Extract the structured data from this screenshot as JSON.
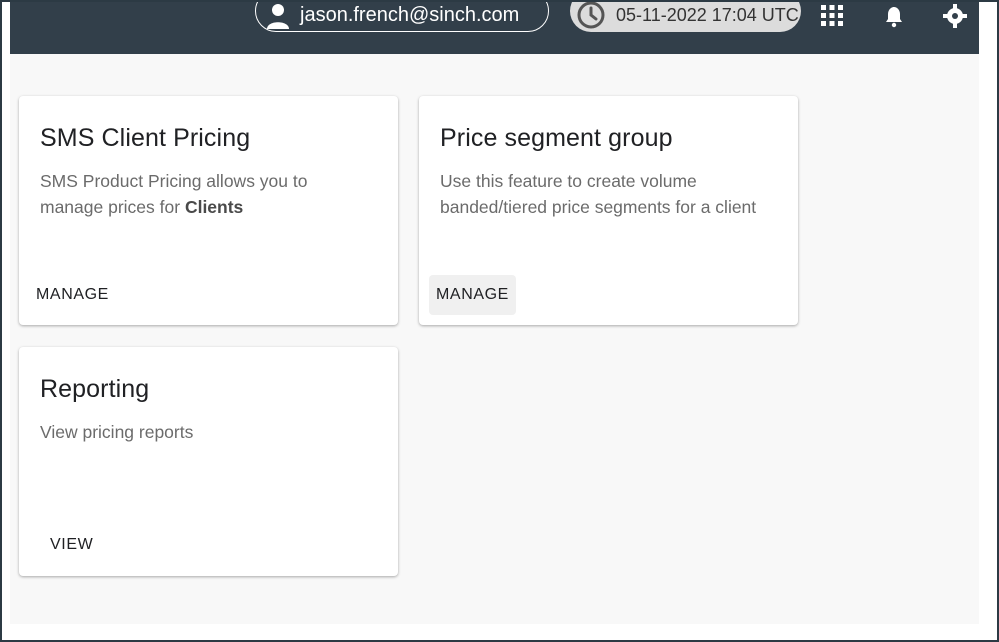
{
  "header": {
    "user_email": "jason.french@sinch.com",
    "datetime": "05-11-2022 17:04 UTC",
    "icons": [
      "person-icon",
      "clock-icon",
      "apps-grid-icon",
      "bell-icon",
      "gear-icon"
    ]
  },
  "cards": [
    {
      "title": "SMS Client Pricing",
      "description_prefix": "SMS Product Pricing allows you to manage prices for ",
      "description_bold": "Clients",
      "action": "MANAGE"
    },
    {
      "title": "Price segment group",
      "description": "Use this feature to create volume banded/tiered price segments for a client",
      "action": "MANAGE"
    },
    {
      "title": "Reporting",
      "description": "View pricing reports",
      "action": "VIEW"
    }
  ],
  "colors": {
    "topbar": "#323f4a",
    "content_bg": "#f8f8f8",
    "card_bg": "#ffffff",
    "title_text": "#202124",
    "desc_text": "#6b6b6b"
  }
}
